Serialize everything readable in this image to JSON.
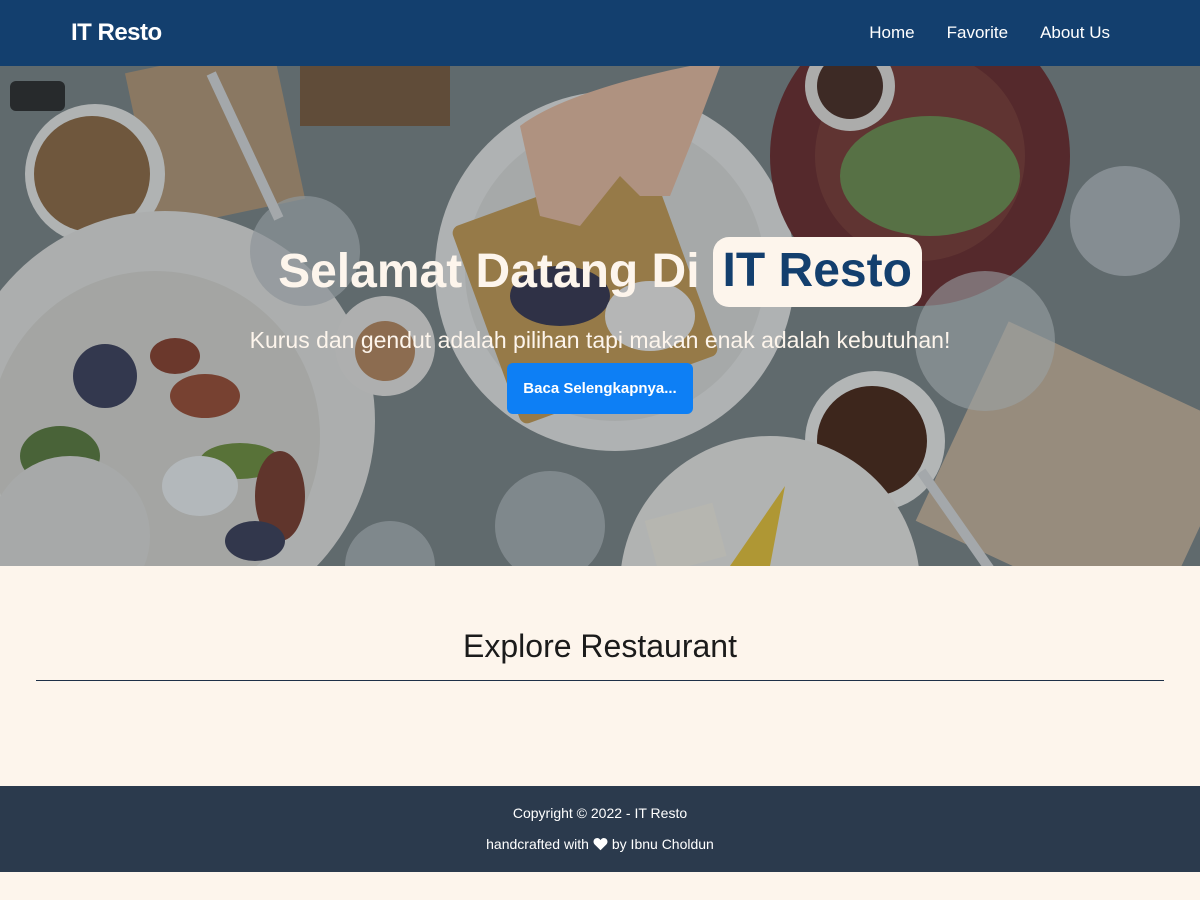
{
  "header": {
    "brand": "IT Resto",
    "nav": [
      {
        "label": "Home"
      },
      {
        "label": "Favorite"
      },
      {
        "label": "About Us"
      }
    ]
  },
  "hero": {
    "title_prefix": "Selamat Datang Di",
    "title_highlight": "IT Resto",
    "tagline": "Kurus dan gendut adalah pilihan tapi makan enak adalah kebutuhan!",
    "button_label": "Baca Selengkapnya..."
  },
  "explore": {
    "title": "Explore Restaurant"
  },
  "footer": {
    "copyright": "Copyright © 2022 - IT Resto",
    "credit_prefix": "handcrafted with",
    "credit_suffix": "by Ibnu Choldun",
    "heart_icon": "heart-icon"
  },
  "colors": {
    "header_bg": "#133f6e",
    "page_bg": "#fdf5ec",
    "button_bg": "#0d7ff5",
    "footer_bg": "#2b3a4d"
  }
}
